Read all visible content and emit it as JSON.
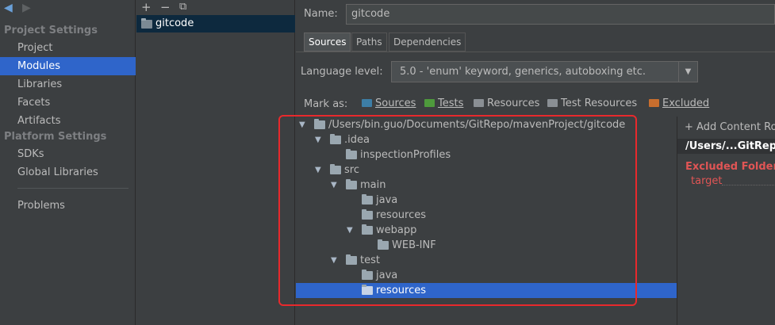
{
  "nav": {
    "back": "◀",
    "forward": "▶",
    "project_settings_header": "Project Settings",
    "project_settings_items": [
      "Project",
      "Modules",
      "Libraries",
      "Facets",
      "Artifacts"
    ],
    "platform_settings_header": "Platform Settings",
    "platform_settings_items": [
      "SDKs",
      "Global Libraries"
    ],
    "problems": "Problems",
    "selected": "Modules"
  },
  "modules": {
    "add": "+",
    "remove": "−",
    "copy": "⧉",
    "items": [
      "gitcode"
    ]
  },
  "module_settings": {
    "name_label": "Name:",
    "name_value": "gitcode",
    "tabs": [
      "Sources",
      "Paths",
      "Dependencies"
    ],
    "active_tab": "Sources",
    "language_level_label": "Language level:",
    "language_level_value": "5.0 - 'enum' keyword, generics, autoboxing etc.",
    "mark_as_label": "Mark as:",
    "mark_as": [
      {
        "label": "Sources",
        "color": "#3d7ea6"
      },
      {
        "label": "Tests",
        "color": "#4e9a3c"
      },
      {
        "label": "Resources",
        "color": "#8a8f94"
      },
      {
        "label": "Test Resources",
        "color": "#8a8f94"
      },
      {
        "label": "Excluded",
        "color": "#c86e2e"
      }
    ]
  },
  "tree": [
    {
      "label": "/Users/bin.guo/Documents/GitRepo/mavenProject/gitcode",
      "expanded": true
    },
    {
      "label": ".idea",
      "expanded": true
    },
    {
      "label": "inspectionProfiles"
    },
    {
      "label": "src",
      "expanded": true
    },
    {
      "label": "main",
      "expanded": true
    },
    {
      "label": "java"
    },
    {
      "label": "resources"
    },
    {
      "label": "webapp",
      "expanded": true
    },
    {
      "label": "WEB-INF"
    },
    {
      "label": "test",
      "expanded": true
    },
    {
      "label": "java"
    },
    {
      "label": "resources",
      "selected": true
    }
  ],
  "content_root": {
    "add_label": "+ Add Content Ro",
    "path": "/Users/...GitRep",
    "excluded_header": "Excluded Folder",
    "excluded_items": [
      "target"
    ]
  },
  "colors": {
    "selection": "#2f65ca",
    "highlight_border": "#e8292c",
    "excluded_text": "#e05555"
  }
}
